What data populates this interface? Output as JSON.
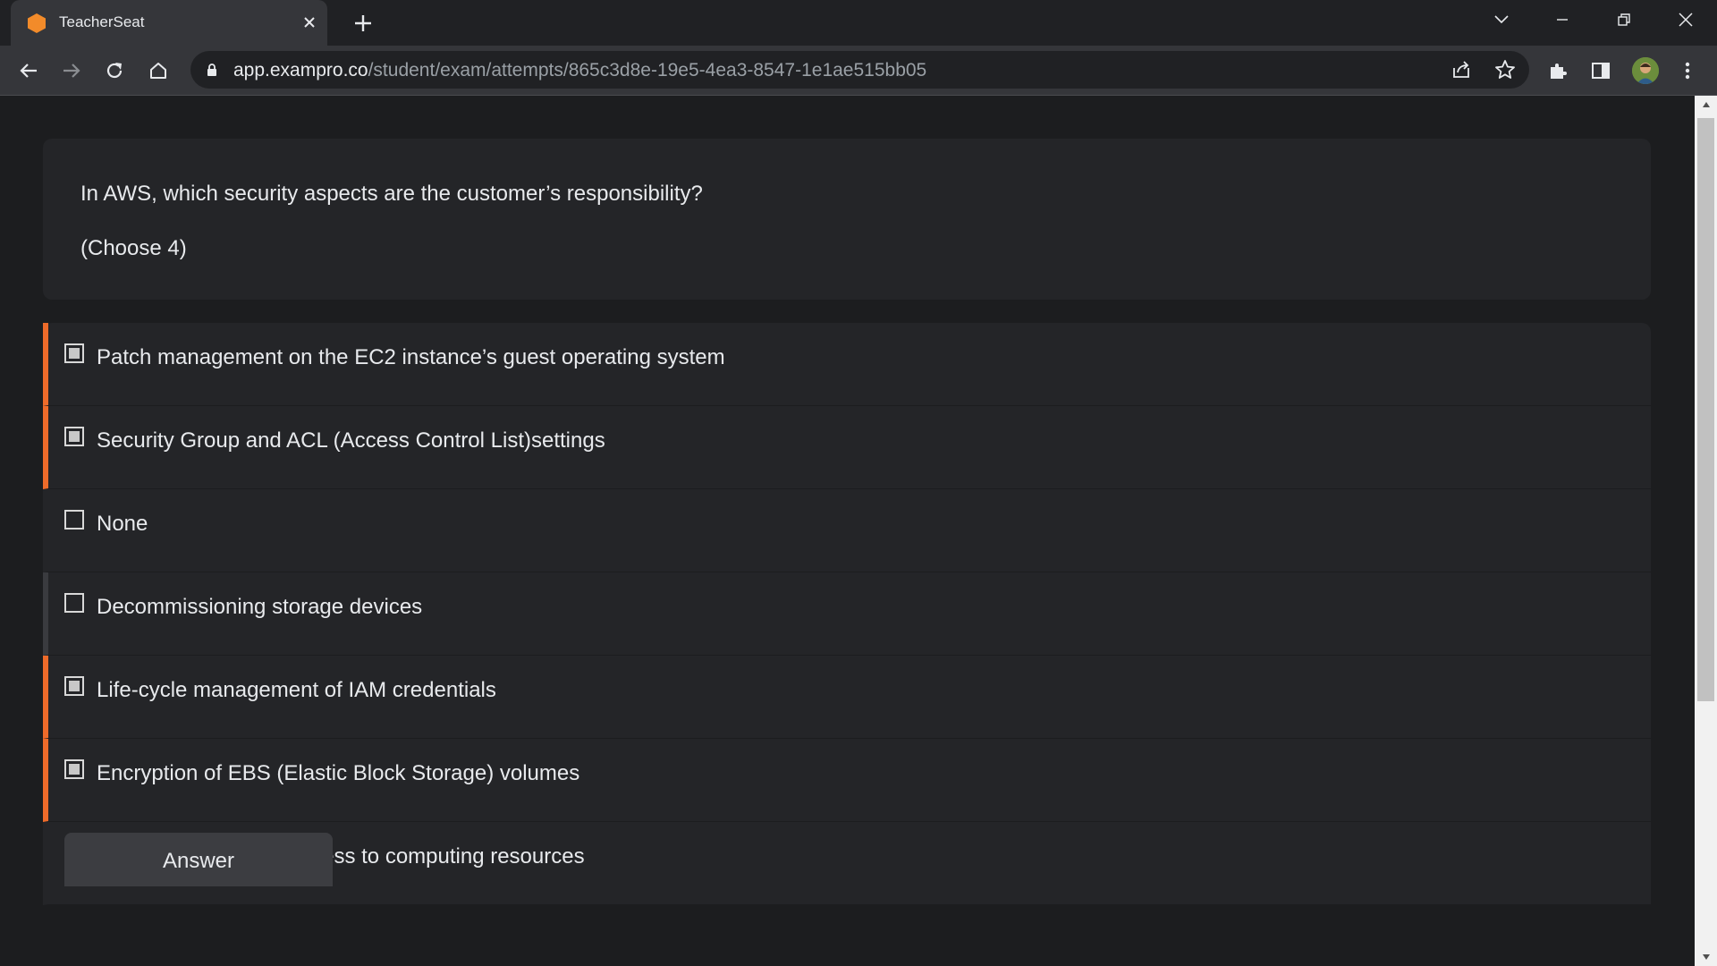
{
  "browser": {
    "tab_title": "TeacherSeat",
    "url_host": "app.exampro.co",
    "url_path": "/student/exam/attempts/865c3d8e-19e5-4ea3-8547-1e1ae515bb05",
    "favicon_color": "#f28b2a",
    "icons": {
      "back": "arrow-left-icon",
      "forward": "arrow-right-icon",
      "reload": "reload-icon",
      "home": "home-icon",
      "share": "share-icon",
      "bookmark": "star-icon",
      "extensions": "puzzle-icon",
      "side_panel": "side-panel-icon",
      "menu": "kebab-menu-icon"
    }
  },
  "question": {
    "text": "In AWS, which security aspects are the customer’s responsibility?",
    "note": "(Choose 4)"
  },
  "options": [
    {
      "label": "Patch management on the EC2 instance’s guest operating system",
      "selected": true
    },
    {
      "label": "Security Group and ACL (Access Control List)settings",
      "selected": true
    },
    {
      "label": "None",
      "selected": false
    },
    {
      "label": "Decommissioning storage devices",
      "selected": false
    },
    {
      "label": "Life-cycle management of IAM credentials",
      "selected": true
    },
    {
      "label": "Encryption of EBS (Elastic Block Storage) volumes",
      "selected": true
    },
    {
      "label": "Controlling physical access to computing resources",
      "selected": false
    }
  ],
  "answer_button": "Answer",
  "colors": {
    "accent": "#ee6b2a",
    "page_bg": "#1c1d1f",
    "card_bg": "#242528"
  }
}
